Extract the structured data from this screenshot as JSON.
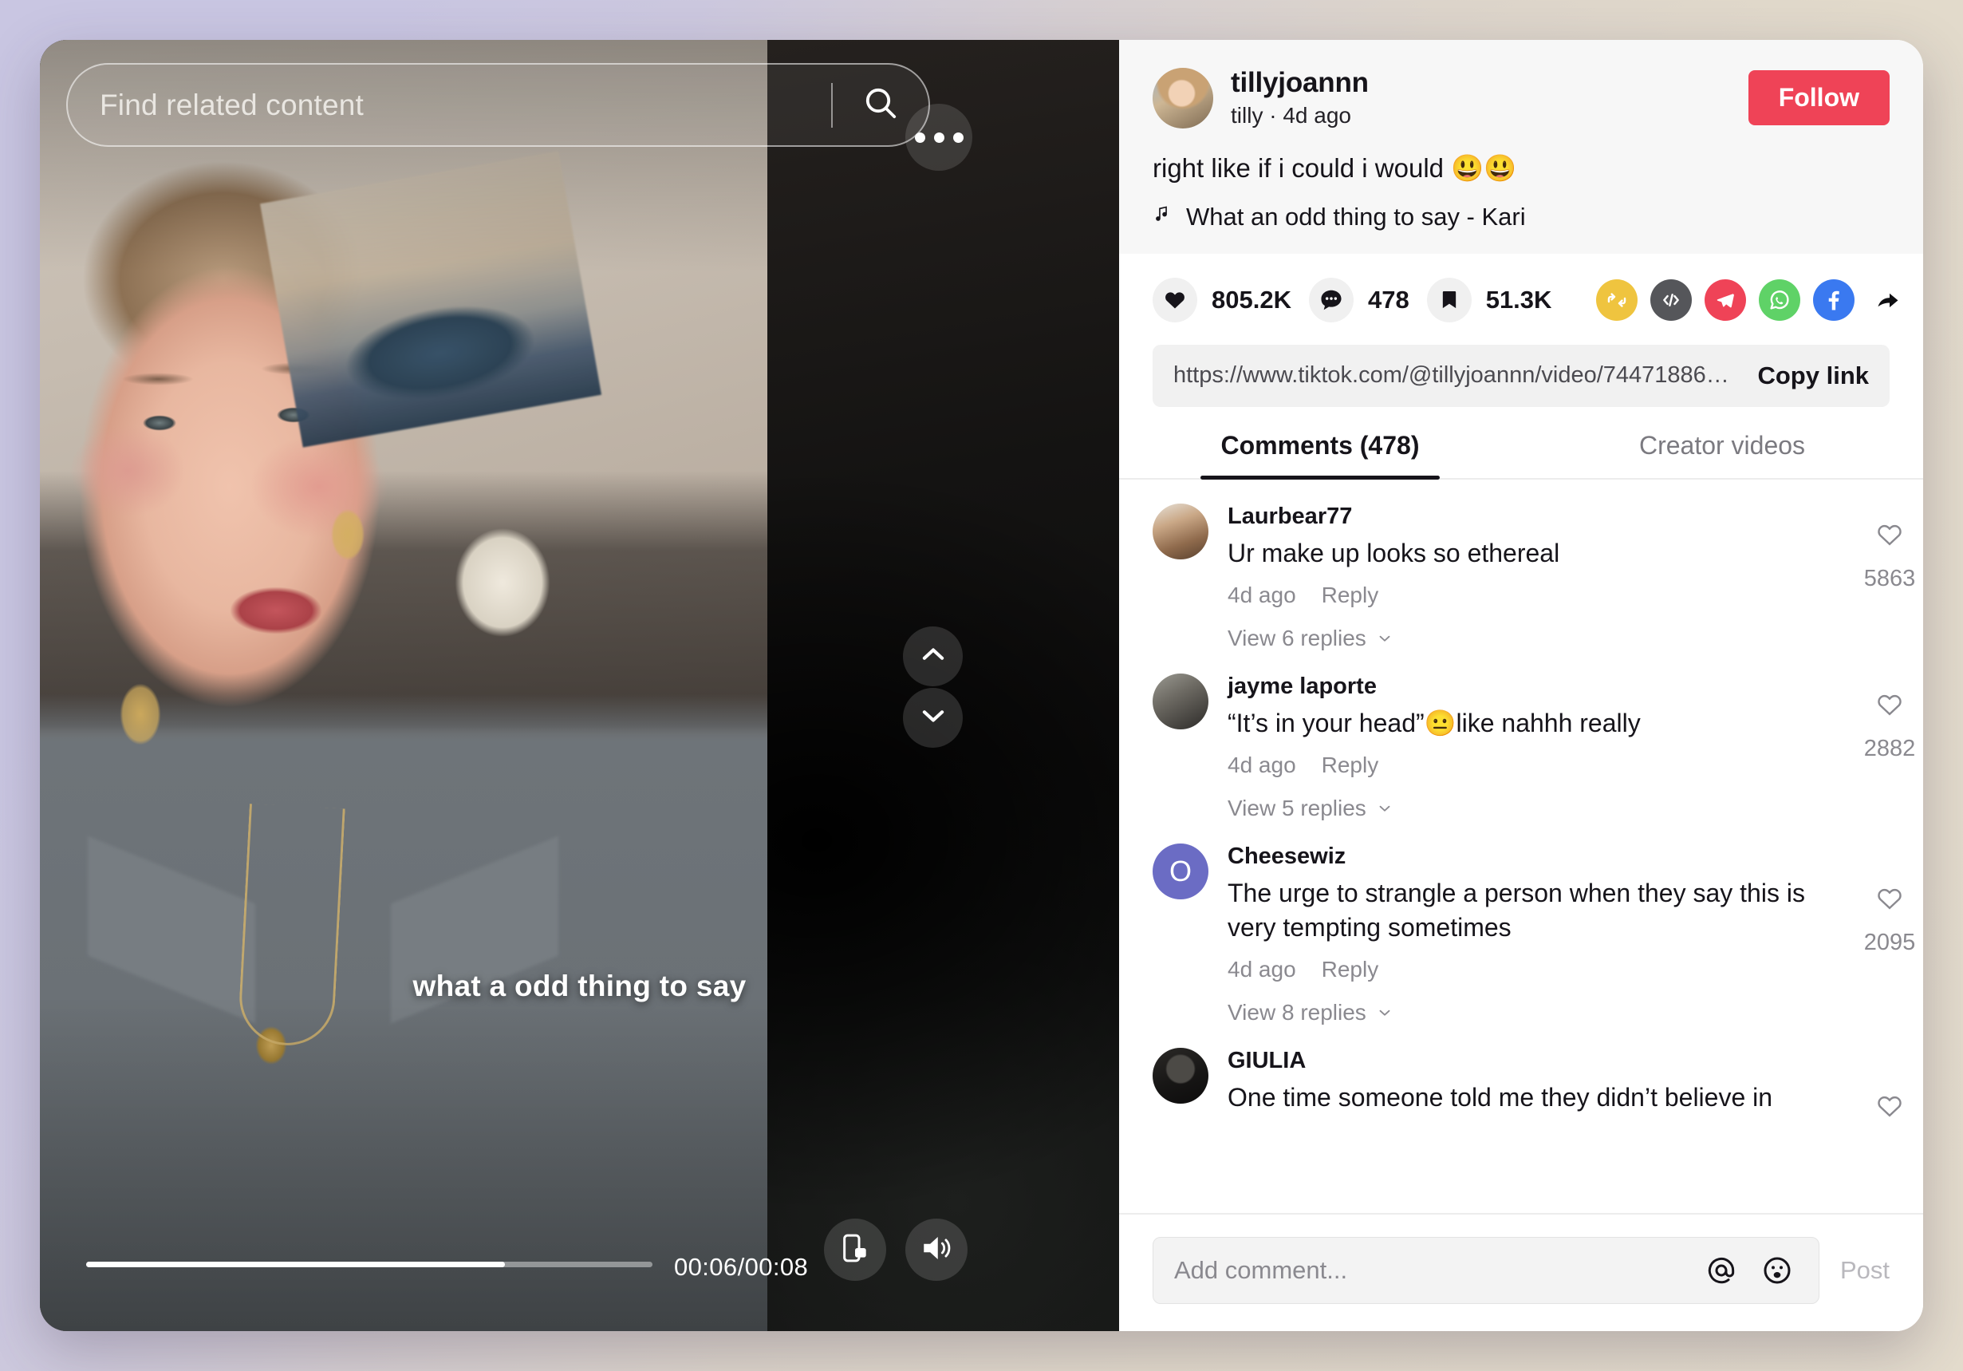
{
  "video": {
    "search_placeholder": "Find related content",
    "caption_overlay": "what a odd thing to say",
    "time_label": "00:06/00:08",
    "progress_percent": 74,
    "icons": {
      "search": "search-icon",
      "more": "more-options-icon",
      "nav_up": "chevron-up-icon",
      "nav_down": "chevron-down-icon",
      "pip": "picture-in-picture-icon",
      "volume": "volume-on-icon"
    }
  },
  "author": {
    "username": "tillyjoannn",
    "subtitle": "tilly · 4d ago",
    "follow_label": "Follow",
    "caption": "right like if i could i would 😃😃",
    "music": "What an odd thing to say - Kari",
    "music_icon": "music-note-icon"
  },
  "stats": {
    "likes": "805.2K",
    "comments": "478",
    "bookmarks": "51.3K",
    "like_icon": "heart-filled-icon",
    "comment_icon": "comment-icon",
    "bookmark_icon": "bookmark-icon"
  },
  "share": {
    "items": [
      {
        "name": "repost-icon",
        "color": "#efc43f"
      },
      {
        "name": "embed-code-icon",
        "color": "#55565a"
      },
      {
        "name": "telegram-icon",
        "color": "#ef4357"
      },
      {
        "name": "whatsapp-icon",
        "color": "#5fd267"
      },
      {
        "name": "facebook-icon",
        "color": "#3a79f0"
      },
      {
        "name": "share-arrow-icon",
        "color": "#0f0f12"
      }
    ]
  },
  "link": {
    "url": "https://www.tiktok.com/@tillyjoannn/video/74471886…",
    "copy_label": "Copy link"
  },
  "tabs": [
    {
      "label": "Comments (478)",
      "active": true
    },
    {
      "label": "Creator videos",
      "active": false
    }
  ],
  "comments": [
    {
      "name": "Laurbear77",
      "text": "Ur make up looks so ethereal",
      "time": "4d ago",
      "reply": "Reply",
      "likes": "5863",
      "replies_label": "View 6 replies",
      "avatar": "av-laur"
    },
    {
      "name": "jayme laporte",
      "text": "“It’s in your head”😐like nahhh really",
      "time": "4d ago",
      "reply": "Reply",
      "likes": "2882",
      "replies_label": "View 5 replies",
      "avatar": "av-jayme"
    },
    {
      "name": "Cheesewiz",
      "text": "The urge to strangle a person when they say this is very tempting sometimes",
      "time": "4d ago",
      "reply": "Reply",
      "likes": "2095",
      "replies_label": "View 8 replies",
      "avatar": "av-cheese",
      "avatar_letter": "O"
    },
    {
      "name": "GIULIA",
      "text": "One time someone told me they didn’t believe in",
      "time": "",
      "reply": "",
      "likes": "",
      "replies_label": "",
      "avatar": "av-giulia"
    }
  ],
  "composer": {
    "placeholder": "Add comment...",
    "post_label": "Post",
    "mention_icon": "at-mention-icon",
    "emoji_icon": "emoji-icon"
  },
  "colors": {
    "accent": "#ef4357",
    "text": "#16141a",
    "muted": "#8a898f"
  }
}
